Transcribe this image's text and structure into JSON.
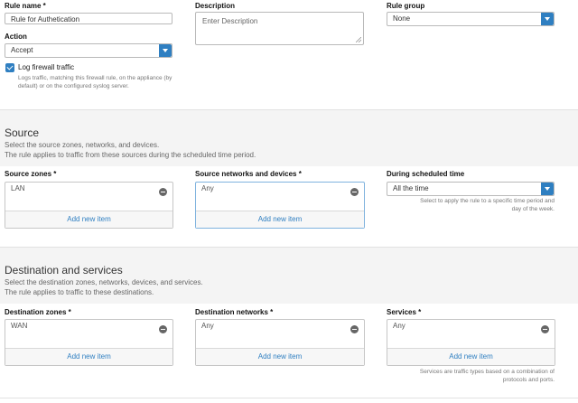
{
  "rule": {
    "name_label": "Rule name *",
    "name_value": "Rule for Authetication",
    "description_label": "Description",
    "description_placeholder": "Enter Description",
    "group_label": "Rule group",
    "group_value": "None",
    "action_label": "Action",
    "action_value": "Accept",
    "log_label": "Log firewall traffic",
    "log_checked": true,
    "log_help_1": "Logs traffic, matching this firewall rule, on the appliance (by",
    "log_help_2": "default) or on the configured syslog server."
  },
  "source": {
    "title": "Source",
    "desc_1": "Select the source zones, networks, and devices.",
    "desc_2": "The rule applies to traffic from these sources during the scheduled time period.",
    "zones_label": "Source zones *",
    "zones_item": "LAN",
    "networks_label": "Source networks and devices *",
    "networks_item": "Any",
    "schedule_label": "During scheduled time",
    "schedule_value": "All the time",
    "schedule_help_1": "Select to apply the rule to a specific time period and",
    "schedule_help_2": "day of the week.",
    "add_label": "Add new item"
  },
  "destination": {
    "title": "Destination and services",
    "desc_1": "Select the destination zones, networks, devices, and services.",
    "desc_2": "The rule applies to traffic to these destinations.",
    "zones_label": "Destination zones *",
    "zones_item": "WAN",
    "networks_label": "Destination networks *",
    "networks_item": "Any",
    "services_label": "Services *",
    "services_item": "Any",
    "services_help_1": "Services are traffic types based on a combination of",
    "services_help_2": "protocols and ports.",
    "add_label": "Add new item"
  },
  "colors": {
    "accent": "#2f7fc1",
    "section_bg": "#f4f4f4"
  }
}
